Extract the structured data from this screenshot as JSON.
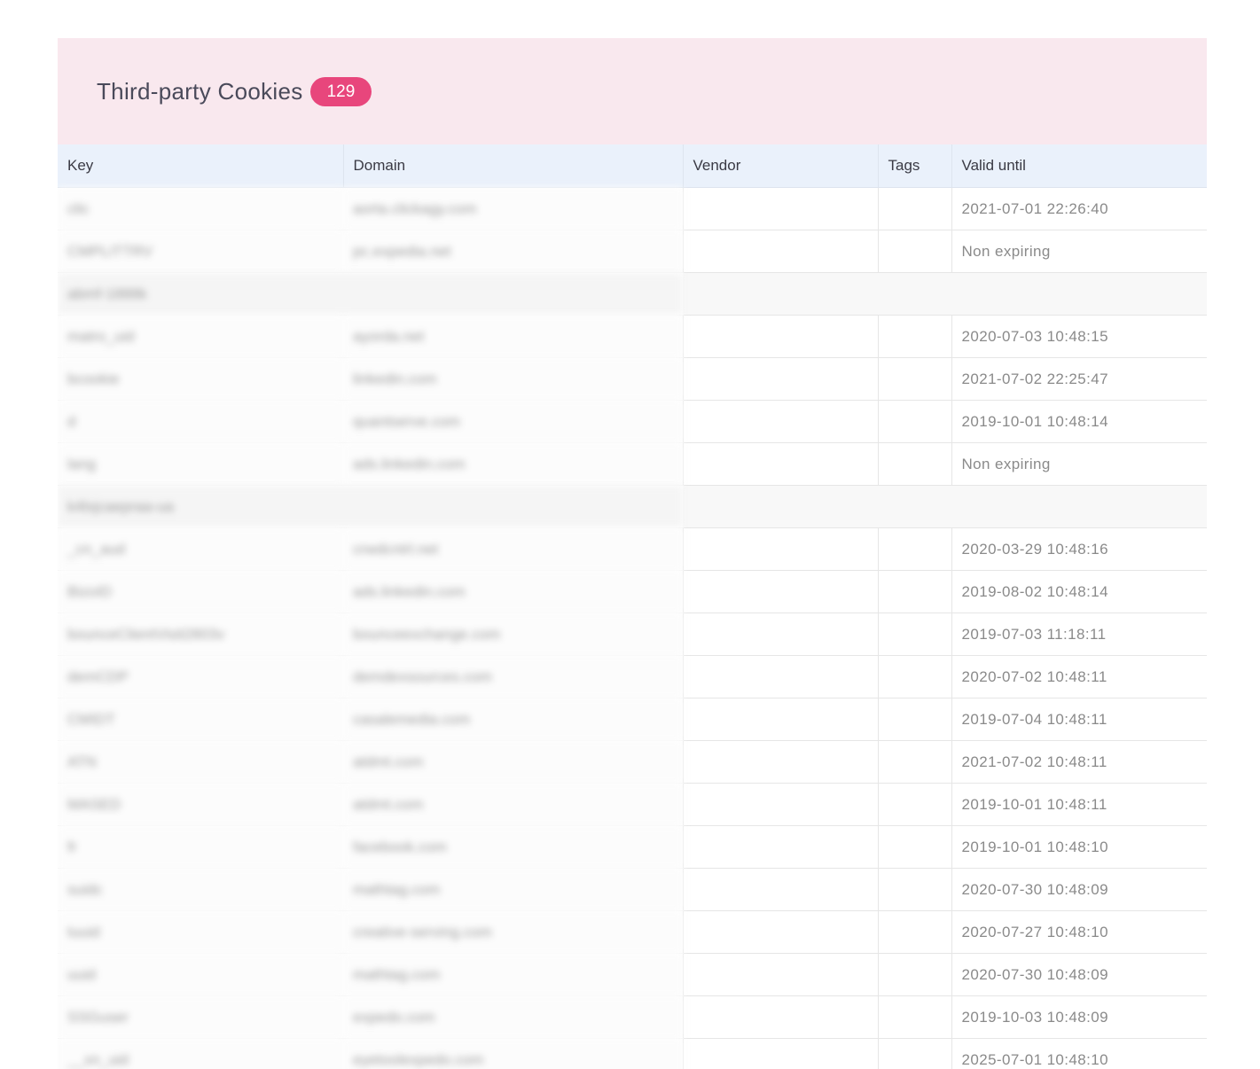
{
  "panel": {
    "title": "Third-party Cookies",
    "count": "129",
    "accent_color": "#e8467c",
    "header_bg": "#f9e8ee"
  },
  "table": {
    "columns": [
      "Key",
      "Domain",
      "Vendor",
      "Tags",
      "Valid until"
    ],
    "rows": [
      {
        "type": "row",
        "key": "clic",
        "domain": "aorta.clickagy.com",
        "vendor": "",
        "tags": "",
        "valid": "2021-07-01 22:26:40"
      },
      {
        "type": "row",
        "key": "CMPLITTRV",
        "domain": "pc.expedia.net",
        "vendor": "",
        "tags": "",
        "valid": "Non expiring"
      },
      {
        "type": "group",
        "label": "abmf-1888k"
      },
      {
        "type": "row",
        "key": "matro_uid",
        "domain": "ayorda.net",
        "vendor": "",
        "tags": "",
        "valid": "2020-07-03 10:48:15"
      },
      {
        "type": "row",
        "key": "bcookie",
        "domain": "linkedin.com",
        "vendor": "",
        "tags": "",
        "valid": "2021-07-02 22:25:47"
      },
      {
        "type": "row",
        "key": "d",
        "domain": "quantserve.com",
        "vendor": "",
        "tags": "",
        "valid": "2019-10-01 10:48:14"
      },
      {
        "type": "row",
        "key": "lang",
        "domain": "ads.linkedin.com",
        "vendor": "",
        "tags": "",
        "valid": "Non expiring"
      },
      {
        "type": "group",
        "label": "k4lxjcaepraa-ua"
      },
      {
        "type": "row",
        "key": "_cn_aud",
        "domain": "crwdcntrl.net",
        "vendor": "",
        "tags": "",
        "valid": "2020-03-29 10:48:16"
      },
      {
        "type": "row",
        "key": "BizoID",
        "domain": "ads.linkedin.com",
        "vendor": "",
        "tags": "",
        "valid": "2019-08-02 10:48:14"
      },
      {
        "type": "row",
        "key": "bounceClientVisit2803v",
        "domain": "bounceexchange.com",
        "vendor": "",
        "tags": "",
        "valid": "2019-07-03 11:18:11"
      },
      {
        "type": "row",
        "key": "demCDP",
        "domain": "demdexsources.com",
        "vendor": "",
        "tags": "",
        "valid": "2020-07-02 10:48:11"
      },
      {
        "type": "row",
        "key": "CMIDT",
        "domain": "casalemedia.com",
        "vendor": "",
        "tags": "",
        "valid": "2019-07-04 10:48:11"
      },
      {
        "type": "row",
        "key": "ATN",
        "domain": "atdmt.com",
        "vendor": "",
        "tags": "",
        "valid": "2021-07-02 10:48:11"
      },
      {
        "type": "row",
        "key": "MASED",
        "domain": "atdmt.com",
        "vendor": "",
        "tags": "",
        "valid": "2019-10-01 10:48:11"
      },
      {
        "type": "row",
        "key": "fr",
        "domain": "facebook.com",
        "vendor": "",
        "tags": "",
        "valid": "2019-10-01 10:48:10"
      },
      {
        "type": "row",
        "key": "suidc",
        "domain": "mathtag.com",
        "vendor": "",
        "tags": "",
        "valid": "2020-07-30 10:48:09"
      },
      {
        "type": "row",
        "key": "tuuid",
        "domain": "creative-serving.com",
        "vendor": "",
        "tags": "",
        "valid": "2020-07-27 10:48:10"
      },
      {
        "type": "row",
        "key": "uuid",
        "domain": "mathtag.com",
        "vendor": "",
        "tags": "",
        "valid": "2020-07-30 10:48:09"
      },
      {
        "type": "row",
        "key": "SSGuser",
        "domain": "expedo.com",
        "vendor": "",
        "tags": "",
        "valid": "2019-10-03 10:48:09"
      },
      {
        "type": "row",
        "key": "__xn_uid",
        "domain": "eyetoolexpedo.com",
        "vendor": "",
        "tags": "",
        "valid": "2025-07-01 10:48:10"
      }
    ]
  }
}
